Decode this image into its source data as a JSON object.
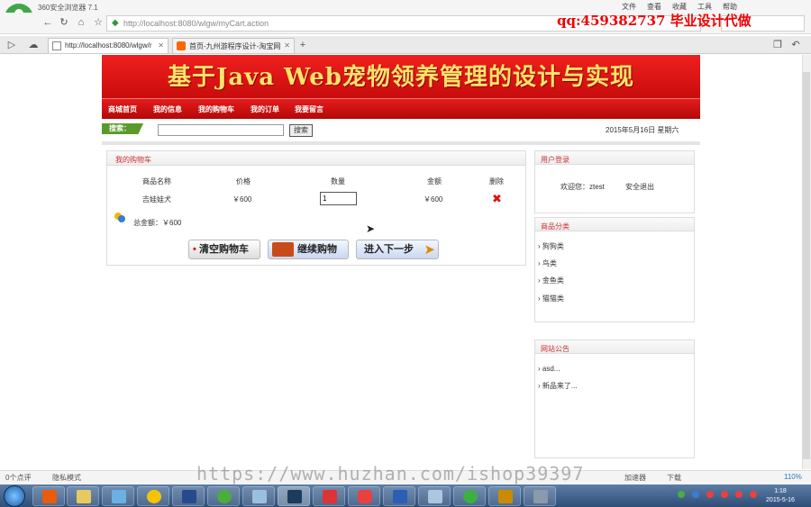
{
  "browser": {
    "name": "360安全浏览器 7.1",
    "menu": [
      "文件",
      "查看",
      "收藏",
      "工具",
      "帮助"
    ],
    "url": "http://localhost:8080/wlgw/myCart.action",
    "tabs": [
      {
        "label": "http://localhost:8080/wlgw/r",
        "active": true
      },
      {
        "label": "首页-九州游程序设计-淘宝网",
        "active": false
      }
    ],
    "status_left": [
      "0个点评",
      "隐私模式"
    ],
    "status_right": [
      "加速器",
      "下载",
      "110%"
    ]
  },
  "watermarks": {
    "qq": "qq:459382737 毕业设计代做",
    "url": "https://www.huzhan.com/ishop39397"
  },
  "site": {
    "title": "基于Java Web宠物领养管理的设计与实现",
    "nav": [
      "商城首页",
      "我的信息",
      "我的购物车",
      "我的订单",
      "我要留言"
    ],
    "search_label": "搜索：",
    "search_button": "搜索",
    "search_value": "",
    "date": "2015年5月16日 星期六"
  },
  "cart": {
    "title": "我的购物车",
    "headers": [
      "商品名称",
      "价格",
      "数量",
      "金额",
      "删除"
    ],
    "rows": [
      {
        "name": "吉娃娃犬",
        "price": "￥600",
        "qty": "1",
        "amount": "￥600"
      }
    ],
    "total_label": "总金额：￥600",
    "buttons": {
      "clear": "清空购物车",
      "continue": "继续购物",
      "next": "进入下一步"
    }
  },
  "sidebar": {
    "login": {
      "title": "用户登录",
      "welcome": "欢迎您：ztest",
      "logout": "安全退出"
    },
    "categories": {
      "title": "商品分类",
      "items": [
        "狗狗类",
        "鸟类",
        "金鱼类",
        "猫猫类"
      ]
    },
    "notices": {
      "title": "网站公告",
      "items": [
        "asd...",
        "新品来了..."
      ]
    }
  },
  "taskbar": {
    "time": "1:18",
    "date": "2015-5-16"
  },
  "colors": {
    "banner_red": "#d81414",
    "title_yellow": "#ffe36b",
    "accent_green": "#5a9a2a",
    "link_red": "#cc3333"
  }
}
